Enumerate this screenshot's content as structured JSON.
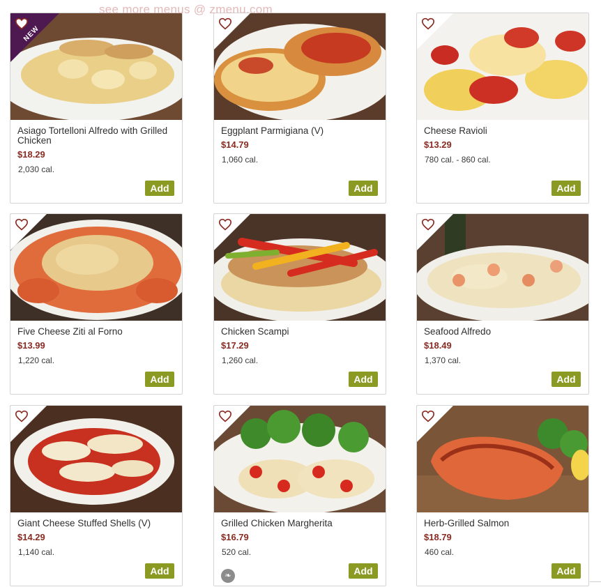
{
  "watermark": "see more menus @ zmenu.com",
  "add_label": "Add",
  "colors": {
    "price": "#8a2b22",
    "add_button": "#8a9a23",
    "new_ribbon": "#4e1850",
    "heart": "#8a2b22"
  },
  "icons": {
    "favorite": "heart-outline-icon",
    "dietary": "vegetarian-leaf-icon"
  },
  "items": [
    {
      "name": "Asiago Tortelloni Alfredo with Grilled Chicken",
      "price": "$18.29",
      "calories": "2,030 cal.",
      "badge": "NEW"
    },
    {
      "name": "Eggplant Parmigiana (V)",
      "price": "$14.79",
      "calories": "1,060 cal."
    },
    {
      "name": "Cheese Ravioli",
      "price": "$13.29",
      "calories": "780 cal. - 860 cal."
    },
    {
      "name": "Five Cheese Ziti al Forno",
      "price": "$13.99",
      "calories": "1,220 cal."
    },
    {
      "name": "Chicken Scampi",
      "price": "$17.29",
      "calories": "1,260 cal."
    },
    {
      "name": "Seafood Alfredo",
      "price": "$18.49",
      "calories": "1,370 cal."
    },
    {
      "name": "Giant Cheese Stuffed Shells (V)",
      "price": "$14.29",
      "calories": "1,140 cal."
    },
    {
      "name": "Grilled Chicken Margherita",
      "price": "$16.79",
      "calories": "520 cal.",
      "icon": "vegetarian-leaf-icon"
    },
    {
      "name": "Herb-Grilled Salmon",
      "price": "$18.79",
      "calories": "460 cal."
    }
  ]
}
